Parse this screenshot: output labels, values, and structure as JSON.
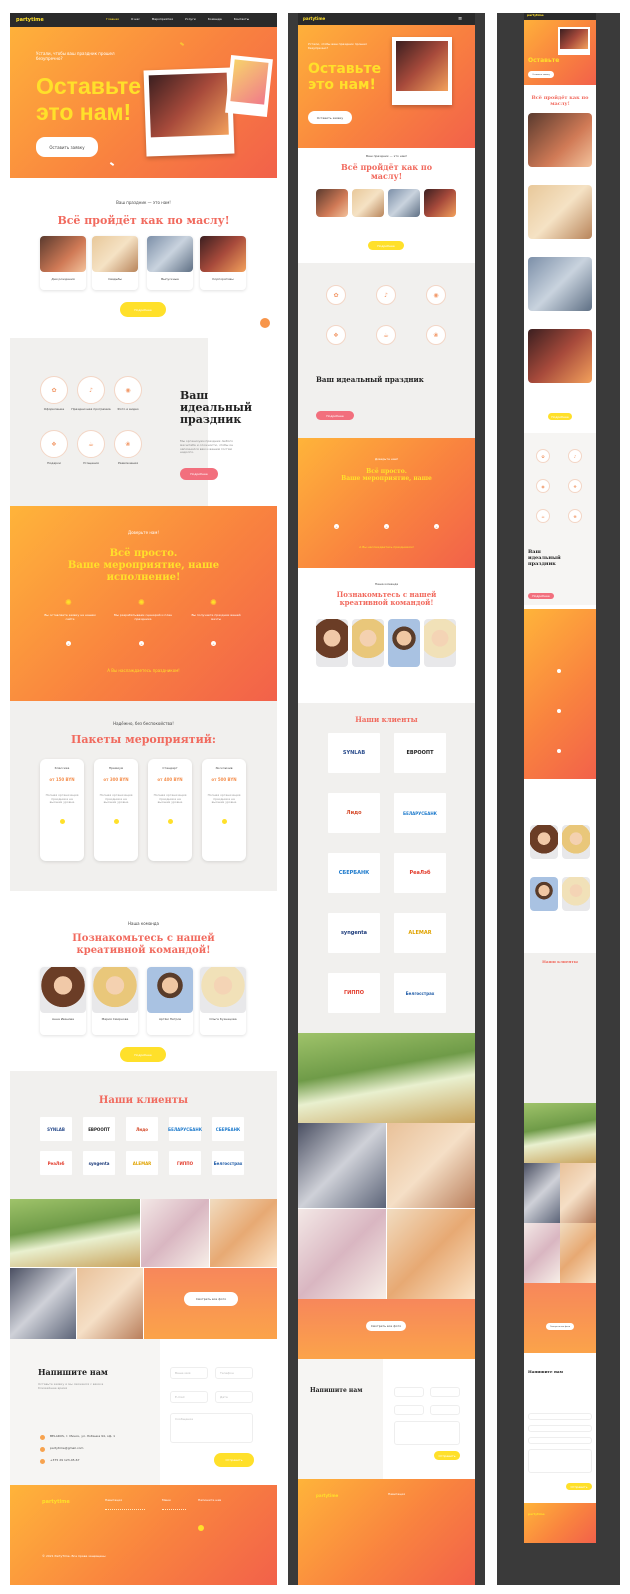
{
  "brand": {
    "name": "partytime",
    "accent": "#f16a5e",
    "yellow": "#ffe02a",
    "orange": "#f9833f"
  },
  "nav": {
    "items": [
      "Главная",
      "О нас",
      "Мероприятия",
      "Услуги",
      "Команда",
      "Контакты"
    ]
  },
  "hero": {
    "subtitle": "Устали, чтобы ваш праздник прошел безупречно?",
    "title_line1": "Оставьте",
    "title_line2": "это нам!",
    "button": "Оставить заявку"
  },
  "events": {
    "kicker": "Ваш праздник — это нам!",
    "title": "Всё пройдёт как по маслу!",
    "items": [
      "Дни рождения",
      "Свадьбы",
      "Выпускные",
      "Корпоративы"
    ],
    "button": "Подробнее"
  },
  "ideal": {
    "title_line1": "Ваш",
    "title_line2": "идеальный",
    "title_line3": "праздник",
    "text": "Мы организуем праздник любого масштаба и сложности, чтобы он запомнился вам и вашим гостям надолго.",
    "icons": [
      "Оформление",
      "Праздничная программа",
      "Фото и видео",
      "Подарки",
      "Угощения",
      "Развлечения"
    ],
    "button": "Подробнее"
  },
  "simple": {
    "kicker": "Доверьте нам!",
    "title_line1": "Всё просто.",
    "title_line2": "Ваше мероприятие, наше",
    "title_line3": "исполнение!",
    "steps": [
      "Вы оставляете заявку на нашем сайте",
      "Мы разрабатываем сценарий и план праздника",
      "Вы получаете праздник вашей мечты"
    ],
    "footer": "А Вы наслаждаетесь праздником!"
  },
  "packages": {
    "kicker": "Надёжно, без беспокойства!",
    "title": "Пакеты мероприятий:",
    "items": [
      {
        "name": "Классика",
        "price": "от 150 BYN",
        "desc": "Полная организация праздника на высшем уровне"
      },
      {
        "name": "Премиум",
        "price": "от 300 BYN",
        "desc": "Полная организация праздника на высшем уровне"
      },
      {
        "name": "Стандарт",
        "price": "от 400 BYN",
        "desc": "Полная организация праздника на высшем уровне"
      },
      {
        "name": "Эксклюзив",
        "price": "от 500 BYN",
        "desc": "Полная организация праздника на высшем уровне"
      }
    ]
  },
  "team": {
    "kicker": "Наша команда",
    "title_line1": "Познакомьтесь с нашей",
    "title_line2": "креативной командой!",
    "members": [
      "Анна Иванова",
      "Мария Смирнова",
      "Артём Петров",
      "Ольга Кузнецова"
    ],
    "button": "Подробнее"
  },
  "clients": {
    "title": "Наши клиенты",
    "logos": [
      "SYNLAB",
      "ЕВРООПТ",
      "Лидо",
      "БЕЛАРУСБАНК",
      "СБЕРБАНК",
      "РеаЛэб",
      "syngenta",
      "ALEMAR",
      "ГИППО",
      "Белгосстрах"
    ]
  },
  "gallery": {
    "button": "Смотреть все фото"
  },
  "contact": {
    "title": "Напишите нам",
    "text": "Оставьте заявку и мы свяжемся с вами в ближайшее время",
    "fields": [
      "Ваше имя",
      "Телефон",
      "E-mail",
      "Дата",
      "Сообщение"
    ],
    "lines": [
      "BELARUS, г. Минск, ул. Лобанка 94, оф. 1",
      "partytime@gmail.com",
      "+375 29 123-45-67"
    ],
    "button": "Отправить"
  },
  "footer": {
    "col1_title": "Навигация",
    "col2_title": "Меню",
    "col3_title": "Напишите нам",
    "copyright": "© 2021 PartyTime. Все права защищены"
  }
}
